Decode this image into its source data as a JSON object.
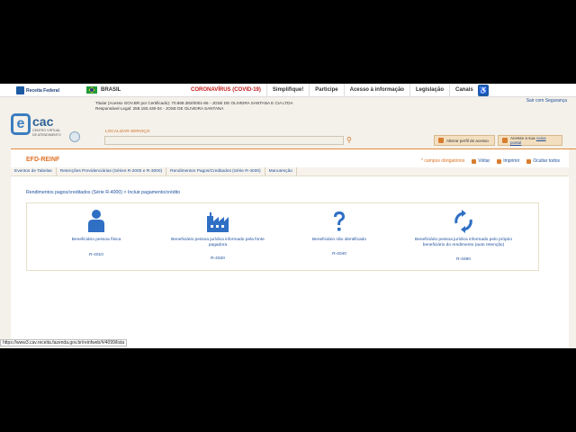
{
  "gov": {
    "logo_text": "Receita Federal",
    "country": "BRASIL",
    "menu": [
      "CORONAVÍRUS (COVID-19)",
      "Simplifique!",
      "Participe",
      "Acesso à informação",
      "Legislação",
      "Canais"
    ]
  },
  "header": {
    "exit_link": "Sair com Segurança",
    "titular_line1": "Titular (Acesso GOV.BR por Certificado): 70.869.382/0001-66 - JOSE DE OLIVEIRA SANTANA E CIA LTDA",
    "titular_line2": "Responsável Legal: 258.193.430-04 - JOSE DE OLIVEIRA SANTANA",
    "ecac_e": "e",
    "ecac_brand": "cac",
    "ecac_sub1": "CENTRO VIRTUAL",
    "ecac_sub2": "DE ATENDIMENTO",
    "search_label": "LOCALIZAR SERVIÇO",
    "search_placeholder": "",
    "btn_perfil": "Alterar perfil de acesso",
    "btn_caixa_prefix": "Acesse a sua ",
    "btn_caixa_link": "caixa postal"
  },
  "efd": {
    "title": "EFD-REINF",
    "required_mark": "*",
    "required_text": "campos obrigatórios",
    "voltar": "Voltar",
    "imprimir": "Imprimir",
    "ocultar": "Ocultar todos",
    "tabs": [
      "Eventos de Tabelas",
      "Retenções Previdenciárias (Séries R-2000 e R-3000)",
      "Rendimentos Pagos/Creditados (Série R-4000)",
      "Manutenção"
    ],
    "breadcrumb": "Rendimentos pagos/creditados (Série R-4000) > Incluir pagamento/crédito",
    "cards": [
      {
        "label": "Beneficiário pessoa física",
        "code": "R-4010",
        "icon": "person-icon"
      },
      {
        "label": "Beneficiário pessoa jurídica informado pela fonte pagadora",
        "code": "R-4020",
        "icon": "factory-icon"
      },
      {
        "label": "Beneficiário não identificado",
        "code": "R-4040",
        "icon": "question-icon"
      },
      {
        "label": "Beneficiário pessoa jurídica informado pelo próprio beneficiário do rendimento (auto retenção)",
        "code": "R-4080",
        "icon": "refresh-icon"
      }
    ]
  },
  "status_url": "https://www3.cav.receita.fazenda.gov.br/reinfweb/#/4099/lista",
  "colors": {
    "accent": "#e07224",
    "link": "#1d4f9b",
    "icon": "#2f6fc4"
  }
}
